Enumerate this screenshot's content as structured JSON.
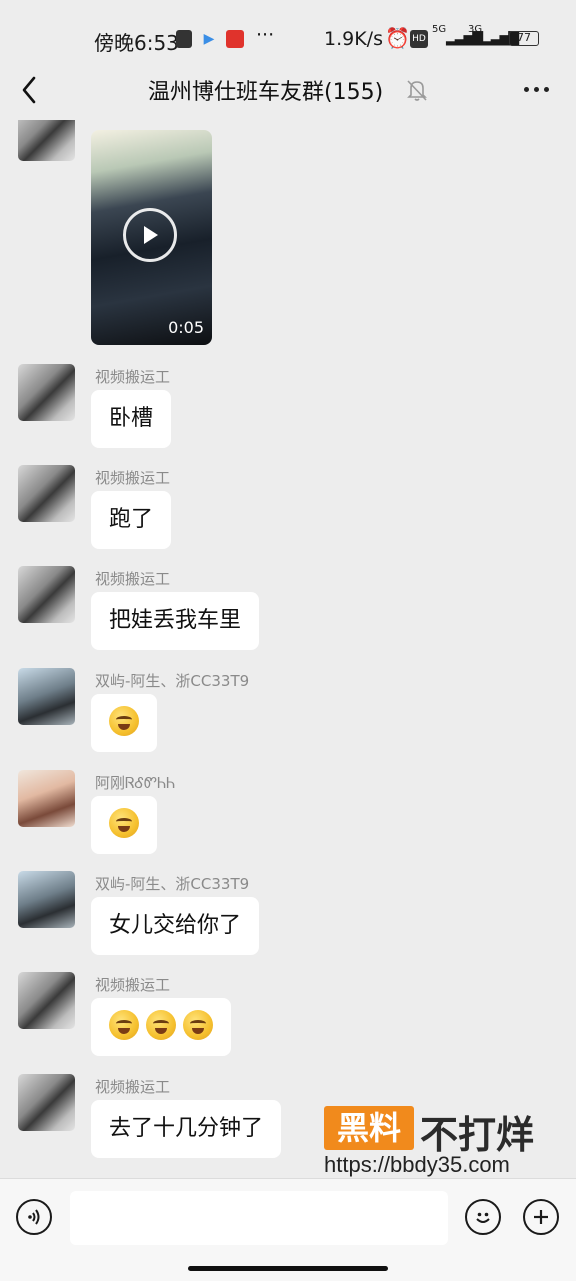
{
  "status_bar": {
    "time": "傍晚6:53",
    "speed": "1.9K/s",
    "hd": "HD",
    "net1": "5G",
    "net2": "3G",
    "battery": "77"
  },
  "header": {
    "title": "温州博仕班车友群(155)"
  },
  "messages": [
    {
      "sender": "",
      "type": "video",
      "duration": "0:05"
    },
    {
      "sender": "视频搬运工",
      "type": "text",
      "text": "卧槽"
    },
    {
      "sender": "视频搬运工",
      "type": "text",
      "text": "跑了"
    },
    {
      "sender": "视频搬运工",
      "type": "text",
      "text": "把娃丢我车里"
    },
    {
      "sender": "双屿-阿生、浙CC33T9",
      "type": "emoji",
      "emoji_count": 1
    },
    {
      "sender": "阿刚ᏒᎴᏛᏂᏂ",
      "type": "emoji",
      "emoji_count": 1
    },
    {
      "sender": "双屿-阿生、浙CC33T9",
      "type": "text",
      "text": "女儿交给你了"
    },
    {
      "sender": "视频搬运工",
      "type": "emoji",
      "emoji_count": 3
    },
    {
      "sender": "视频搬运工",
      "type": "text",
      "text": "去了十几分钟了"
    }
  ],
  "watermark": {
    "badge": "黑料",
    "text": "不打烊",
    "url": "https://bbdy35.com"
  },
  "input_bar": {
    "placeholder": ""
  },
  "icons": {
    "back": "back-chevron-icon",
    "mute": "mute-bell-icon",
    "more": "more-dots-icon",
    "voice": "voice-icon",
    "emoji": "emoji-icon",
    "plus": "plus-icon"
  }
}
